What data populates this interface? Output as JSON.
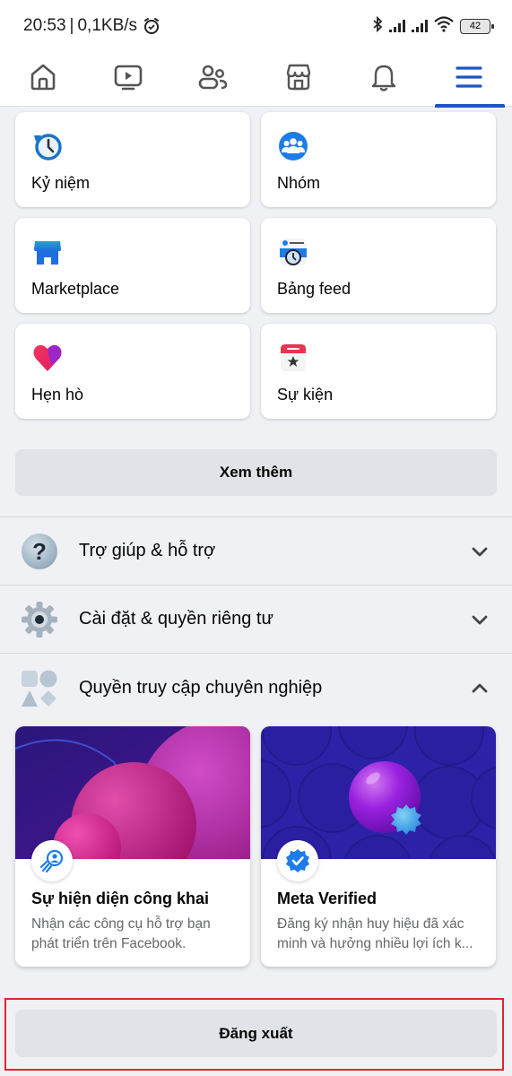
{
  "status_bar": {
    "time": "20:53",
    "separator": "|",
    "network_speed": "0,1KB/s",
    "battery": "42",
    "icons": [
      "alarm-icon",
      "bluetooth-icon",
      "signal-icon",
      "signal-icon",
      "wifi-icon",
      "battery-icon"
    ]
  },
  "nav": {
    "items": [
      {
        "name": "home",
        "icon": "home-icon",
        "active": false
      },
      {
        "name": "video",
        "icon": "video-icon",
        "active": false
      },
      {
        "name": "friends",
        "icon": "friends-icon",
        "active": false
      },
      {
        "name": "marketplace",
        "icon": "marketplace-icon",
        "active": false
      },
      {
        "name": "notifications",
        "icon": "bell-icon",
        "active": false
      },
      {
        "name": "menu",
        "icon": "menu-icon",
        "active": true
      }
    ],
    "active_color": "#1b55c8"
  },
  "shortcuts": [
    {
      "label": "Kỷ niệm",
      "icon": "memories-icon"
    },
    {
      "label": "Nhóm",
      "icon": "groups-icon"
    },
    {
      "label": "Marketplace",
      "icon": "marketplace-shop-icon"
    },
    {
      "label": "Bảng feed",
      "icon": "feeds-icon"
    },
    {
      "label": "Hẹn hò",
      "icon": "dating-heart-icon"
    },
    {
      "label": "Sự kiện",
      "icon": "events-calendar-icon"
    }
  ],
  "see_more_label": "Xem thêm",
  "sections": [
    {
      "label": "Trợ giúp & hỗ trợ",
      "icon": "help-icon",
      "expanded": false
    },
    {
      "label": "Cài đặt & quyền riêng tư",
      "icon": "settings-gear-icon",
      "expanded": false
    },
    {
      "label": "Quyền truy cập chuyên nghiệp",
      "icon": "professional-access-icon",
      "expanded": true
    }
  ],
  "pro_cards": [
    {
      "title": "Sự hiện diện công khai",
      "description": "Nhận các công cụ hỗ trợ bạn phát triển trên Facebook.",
      "icon": "public-presence-icon"
    },
    {
      "title": "Meta Verified",
      "description": "Đăng ký nhận huy hiệu đã xác minh và hưởng nhiều lợi ích k...",
      "icon": "verified-badge-icon"
    }
  ],
  "logout_label": "Đăng xuất",
  "highlight_color": "#e0252f"
}
